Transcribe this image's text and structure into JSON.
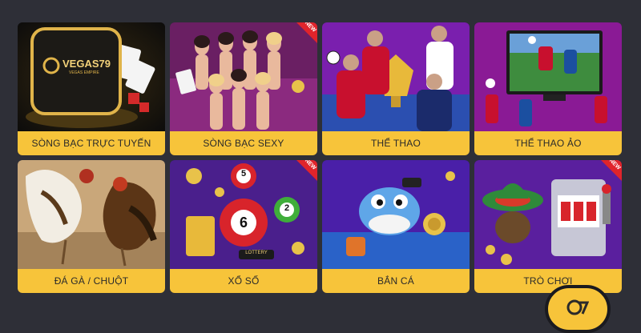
{
  "cards": [
    {
      "label": "SÒNG BẠC TRỰC TUYẾN",
      "logo_text": "VEGAS79",
      "logo_sub": "VEGAS EMPIRE",
      "badge": ""
    },
    {
      "label": "SÒNG BẠC SEXY",
      "badge": "NEW"
    },
    {
      "label": "THỂ THAO",
      "badge": ""
    },
    {
      "label": "THỂ THAO ẢO",
      "badge": ""
    },
    {
      "label": "ĐÁ GÀ / CHUỘT",
      "badge": ""
    },
    {
      "label": "XỔ SỐ",
      "badge": "NEW",
      "balls": [
        "5",
        "6",
        "2"
      ],
      "banner": "LOTTERY"
    },
    {
      "label": "BẮN CÁ",
      "badge": ""
    },
    {
      "label": "TRÒ CHƠI",
      "badge": "NEW"
    }
  ],
  "colors": {
    "background": "#2e2f37",
    "label_bg": "#f7c43a",
    "accent": "#e0242b",
    "gold": "#d9a53a"
  },
  "floating_button": {
    "icon": "vegas79-logo-icon"
  }
}
